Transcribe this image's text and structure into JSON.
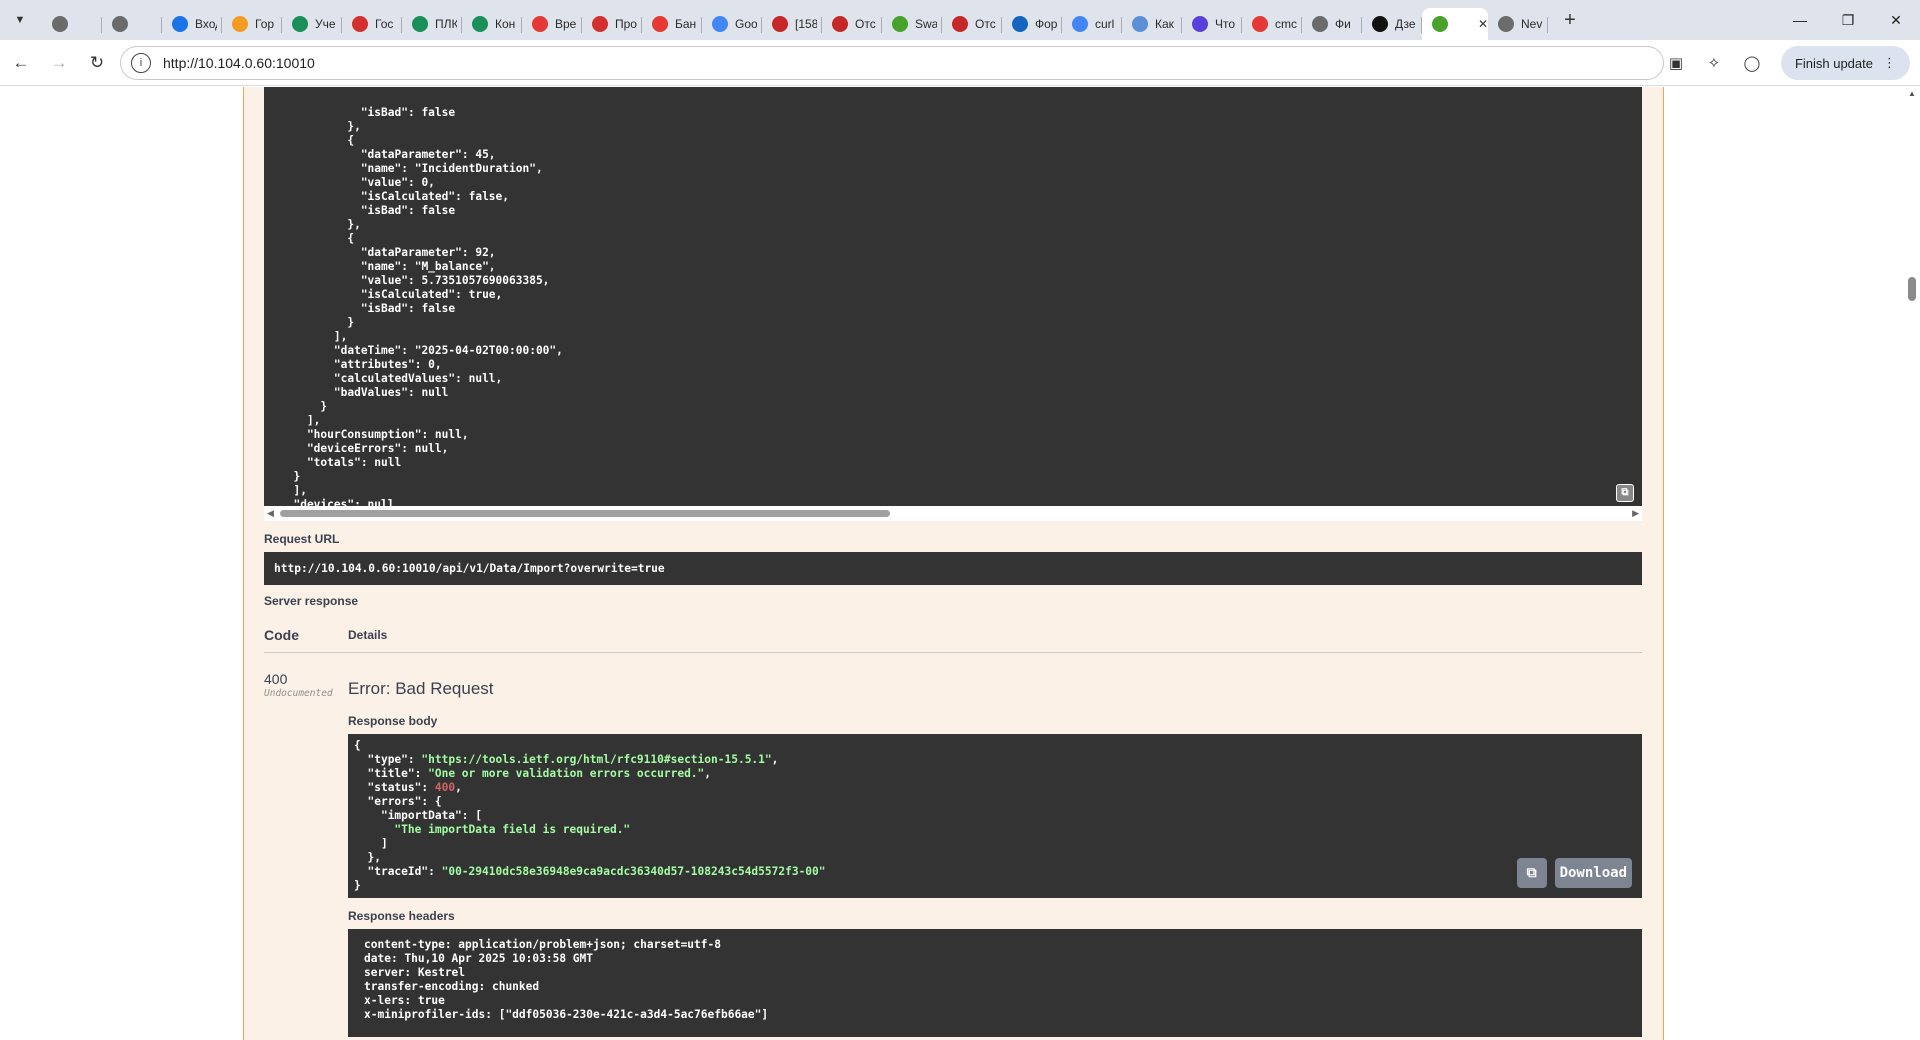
{
  "browser": {
    "tabs": [
      {
        "title": "",
        "icon": "globe-icon",
        "color": "#6b6b6b"
      },
      {
        "title": "",
        "icon": "globe-icon",
        "color": "#6b6b6b"
      },
      {
        "title": "Вход",
        "icon": "shield-icon",
        "color": "#1a73e8"
      },
      {
        "title": "Гор",
        "icon": "orange-circle-icon",
        "color": "#f29b22"
      },
      {
        "title": "Уче",
        "icon": "green-check-icon",
        "color": "#1a8f5a"
      },
      {
        "title": "Гос",
        "icon": "red-logo-icon",
        "color": "#d32f2f"
      },
      {
        "title": "ПЛК",
        "icon": "green-check-icon",
        "color": "#1a8f5a"
      },
      {
        "title": "Кон",
        "icon": "green-check-icon",
        "color": "#1a8f5a"
      },
      {
        "title": "Вре",
        "icon": "red-ring-icon",
        "color": "#e53935"
      },
      {
        "title": "Про",
        "icon": "umbrella-icon",
        "color": "#d32f2f"
      },
      {
        "title": "Бан",
        "icon": "red-ring-icon",
        "color": "#e53935"
      },
      {
        "title": "Goo",
        "icon": "google-icon",
        "color": "#4285f4"
      },
      {
        "title": "[158",
        "icon": "diamond-icon",
        "color": "#c62828"
      },
      {
        "title": "Отс",
        "icon": "diamond-icon",
        "color": "#c62828"
      },
      {
        "title": "Swa",
        "icon": "swagger-icon",
        "color": "#49a32b"
      },
      {
        "title": "Отс",
        "icon": "diamond-icon",
        "color": "#c62828"
      },
      {
        "title": "Фор",
        "icon": "diamond-icon",
        "color": "#1565c0"
      },
      {
        "title": "curl",
        "icon": "google-icon",
        "color": "#4285f4"
      },
      {
        "title": "Как",
        "icon": "image-icon",
        "color": "#5c8fd6"
      },
      {
        "title": "Что",
        "icon": "s-logo-icon",
        "color": "#5b3fd9"
      },
      {
        "title": "cmc",
        "icon": "yandex-icon",
        "color": "#e53935"
      },
      {
        "title": "Фи",
        "icon": "globe-icon",
        "color": "#6b6b6b"
      },
      {
        "title": "Дзе",
        "icon": "zen-icon",
        "color": "#111111"
      },
      {
        "title": "",
        "icon": "swagger-icon",
        "color": "#49a32b",
        "active": true
      },
      {
        "title": "Nev",
        "icon": "globe-icon",
        "color": "#6b6b6b"
      }
    ],
    "url": "http://10.104.0.60:10010",
    "finish_update": "Finish update"
  },
  "request_body_tail": [
    "            \"isBad\": false",
    "          },",
    "          {",
    "            \"dataParameter\": 45,",
    "            \"name\": \"IncidentDuration\",",
    "            \"value\": 0,",
    "            \"isCalculated\": false,",
    "            \"isBad\": false",
    "          },",
    "          {",
    "            \"dataParameter\": 92,",
    "            \"name\": \"M_balance\",",
    "            \"value\": 5.7351057690063385,",
    "            \"isCalculated\": true,",
    "            \"isBad\": false",
    "          }",
    "        ],",
    "        \"dateTime\": \"2025-04-02T00:00:00\",",
    "        \"attributes\": 0,",
    "        \"calculatedValues\": null,",
    "        \"badValues\": null",
    "      }",
    "    ],",
    "    \"hourConsumption\": null,",
    "    \"deviceErrors\": null,",
    "    \"totals\": null",
    "  }",
    "  ],",
    "  \"devices\": null",
    "}'"
  ],
  "request_url": {
    "label": "Request URL",
    "value": "http://10.104.0.60:10010/api/v1/Data/Import?overwrite=true"
  },
  "server_response": {
    "label": "Server response",
    "col_code": "Code",
    "col_details": "Details",
    "code": "400",
    "code_note": "Undocumented",
    "error_title": "Error: Bad Request",
    "body_label": "Response body",
    "body": {
      "type_key": "\"type\"",
      "type_val": "\"https://tools.ietf.org/html/rfc9110#section-15.5.1\"",
      "title_key": "\"title\"",
      "title_val": "\"One or more validation errors occurred.\"",
      "status_key": "\"status\"",
      "status_val": "400",
      "errors_key": "\"errors\"",
      "import_key": "\"importData\"",
      "import_msg": "\"The importData field is required.\"",
      "trace_key": "\"traceId\"",
      "trace_val": "\"00-29410dc58e36948e9ca9acdc36340d57-108243c54d5572f3-00\""
    },
    "download_label": "Download",
    "headers_label": "Response headers",
    "headers": [
      "content-type: application/problem+json; charset=utf-8",
      "date: Thu,10 Apr 2025 10:03:58 GMT",
      "server: Kestrel",
      "transfer-encoding: chunked",
      "x-lers: true",
      "x-miniprofiler-ids: [\"ddf05036-230e-421c-a3d4-5ac76efb66ae\"]"
    ]
  }
}
